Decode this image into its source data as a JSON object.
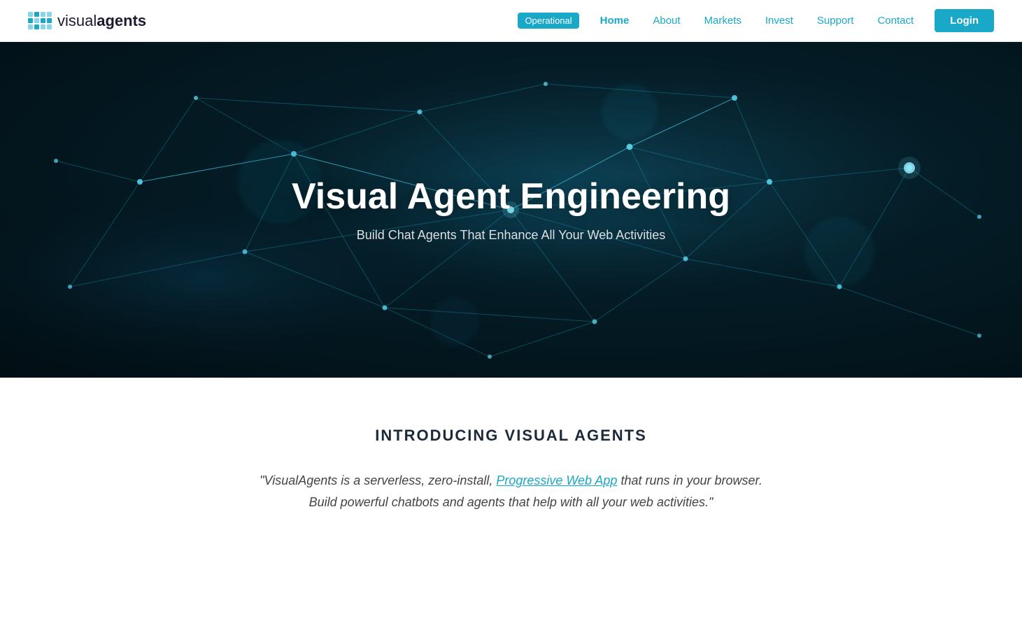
{
  "navbar": {
    "logo_text_regular": "visual",
    "logo_text_bold": "agents",
    "status_badge": "Operational",
    "nav_items": [
      {
        "id": "home",
        "label": "Home",
        "active": true
      },
      {
        "id": "about",
        "label": "About",
        "active": false
      },
      {
        "id": "markets",
        "label": "Markets",
        "active": false
      },
      {
        "id": "invest",
        "label": "Invest",
        "active": false
      },
      {
        "id": "support",
        "label": "Support",
        "active": false
      },
      {
        "id": "contact",
        "label": "Contact",
        "active": false
      }
    ],
    "login_button": "Login"
  },
  "hero": {
    "title": "Visual Agent Engineering",
    "subtitle": "Build Chat Agents That Enhance All Your Web Activities"
  },
  "intro": {
    "heading": "INTRODUCING VISUAL AGENTS",
    "quote_before_link": "\"VisualAgents is a serverless, zero-install, ",
    "quote_link_text": "Progressive Web App",
    "quote_after_link": " that runs in your browser. Build powerful chatbots and agents that help with all your web activities.\""
  }
}
